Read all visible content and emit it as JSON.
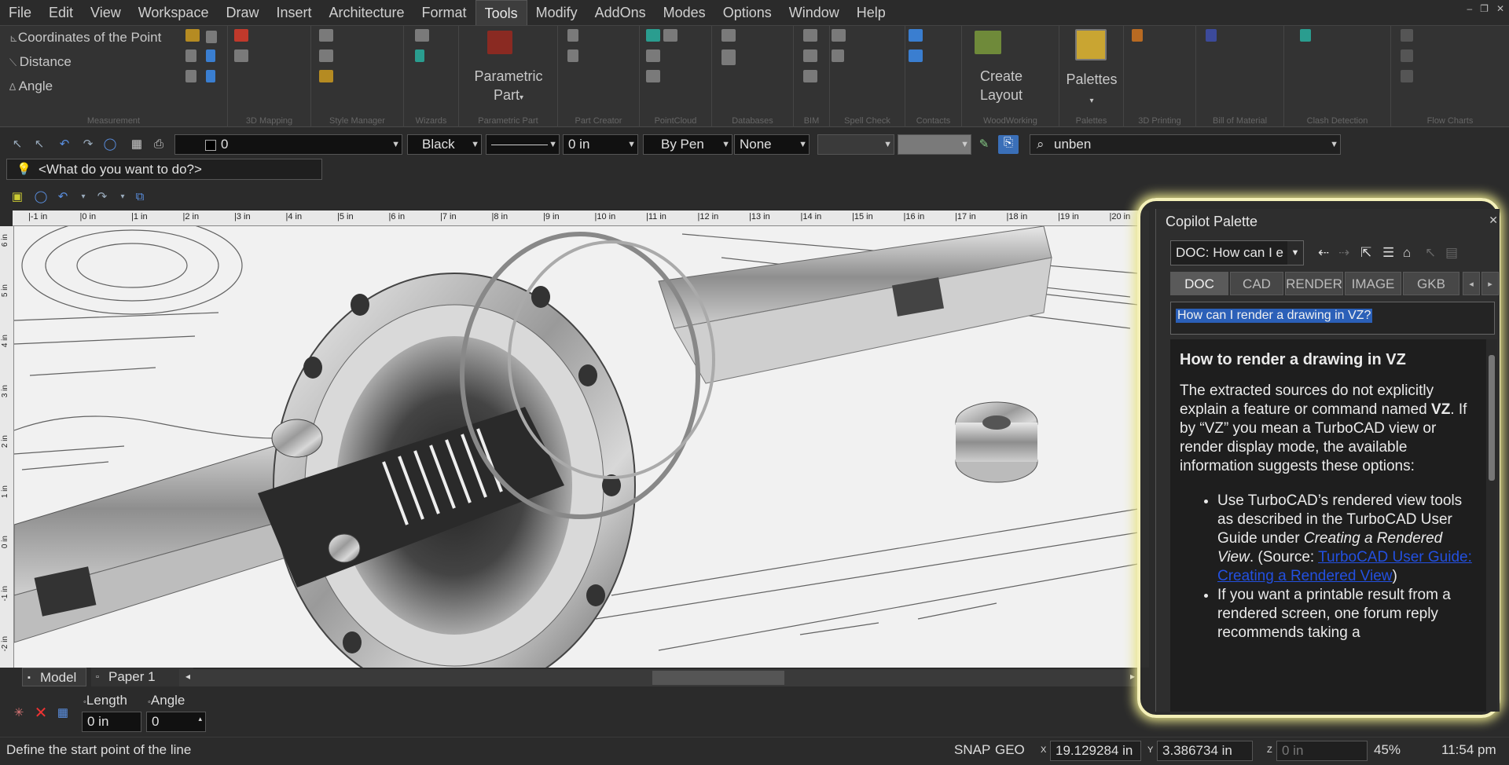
{
  "menu": [
    "File",
    "Edit",
    "View",
    "Workspace",
    "Draw",
    "Insert",
    "Architecture",
    "Format",
    "Tools",
    "Modify",
    "AddOns",
    "Modes",
    "Options",
    "Window",
    "Help"
  ],
  "menu_active": "Tools",
  "ribbon": {
    "measurement": {
      "items": [
        "Coordinates of the Point",
        "Distance",
        "Angle"
      ],
      "label": "Measurement"
    },
    "group_labels": [
      "3D Mapping",
      "Style Manager",
      "Wizards",
      "Parametric Part",
      "Part Creator",
      "PointCloud",
      "Databases",
      "BIM",
      "Spell Check",
      "Contacts",
      "WoodWorking",
      "Palettes",
      "3D Printing",
      "Bill of Material",
      "Clash Detection",
      "Flow Charts"
    ],
    "parametric_part_btn": "Parametric",
    "parametric_part_btn2": "Part",
    "create_layout_btn": "Create",
    "create_layout_btn2": "Layout",
    "palettes_btn": "Palettes"
  },
  "toolbar": {
    "layer": "0",
    "color": "Black",
    "linewidth": "0 in",
    "pen": "By Pen",
    "fill": "None",
    "search": "unben",
    "what_do": "<What do you want to do?>"
  },
  "ruler": {
    "h": [
      "-1 in",
      "0 in",
      "1 in",
      "2 in",
      "3 in",
      "4 in",
      "5 in",
      "6 in",
      "7 in",
      "8 in",
      "9 in",
      "10 in",
      "11 in",
      "12 in",
      "13 in",
      "14 in",
      "15 in",
      "16 in",
      "17 in",
      "18 in",
      "19 in",
      "20 in"
    ],
    "v": [
      "6 in",
      "5 in",
      "4 in",
      "3 in",
      "2 in",
      "1 in",
      "0 in",
      "-1 in",
      "-2 in"
    ]
  },
  "sheets": {
    "model": "Model",
    "paper": "Paper 1"
  },
  "inspector": {
    "length_label": "Length",
    "angle_label": "Angle",
    "length_value": "0 in",
    "angle_value": "0"
  },
  "status": {
    "prompt": "Define the start point of the line",
    "snap": "SNAP",
    "geo": "GEO",
    "x_label": "X",
    "x": "19.129284 in",
    "y_label": "Y",
    "y": "3.386734 in",
    "z_label": "Z",
    "z": "0 in",
    "zoom": "45%",
    "time": "11:54 pm"
  },
  "copilot": {
    "title": "Copilot Palette",
    "combo": "DOC: How can I e",
    "tabs": [
      "DOC",
      "CAD",
      "RENDER",
      "IMAGE",
      "GKB"
    ],
    "active_tab": "DOC",
    "question": "How can I render a drawing in VZ?",
    "answer": {
      "heading": "How to render a drawing in VZ",
      "p1_a": "The extracted sources do not explicitly explain a feature or command named ",
      "p1_bold": "VZ",
      "p1_b": ". If by “VZ” you mean a TurboCAD view or render display mode, the available information suggests these options:",
      "li1_a": "Use TurboCAD’s rendered view tools as described in the TurboCAD User Guide under ",
      "li1_em": "Creating a Rendered View",
      "li1_b": ". (Source: ",
      "li1_link": "TurboCAD User Guide: Creating a Rendered View",
      "li1_c": ")",
      "li2": "If you want a printable result from a rendered screen, one forum reply recommends taking a"
    }
  }
}
